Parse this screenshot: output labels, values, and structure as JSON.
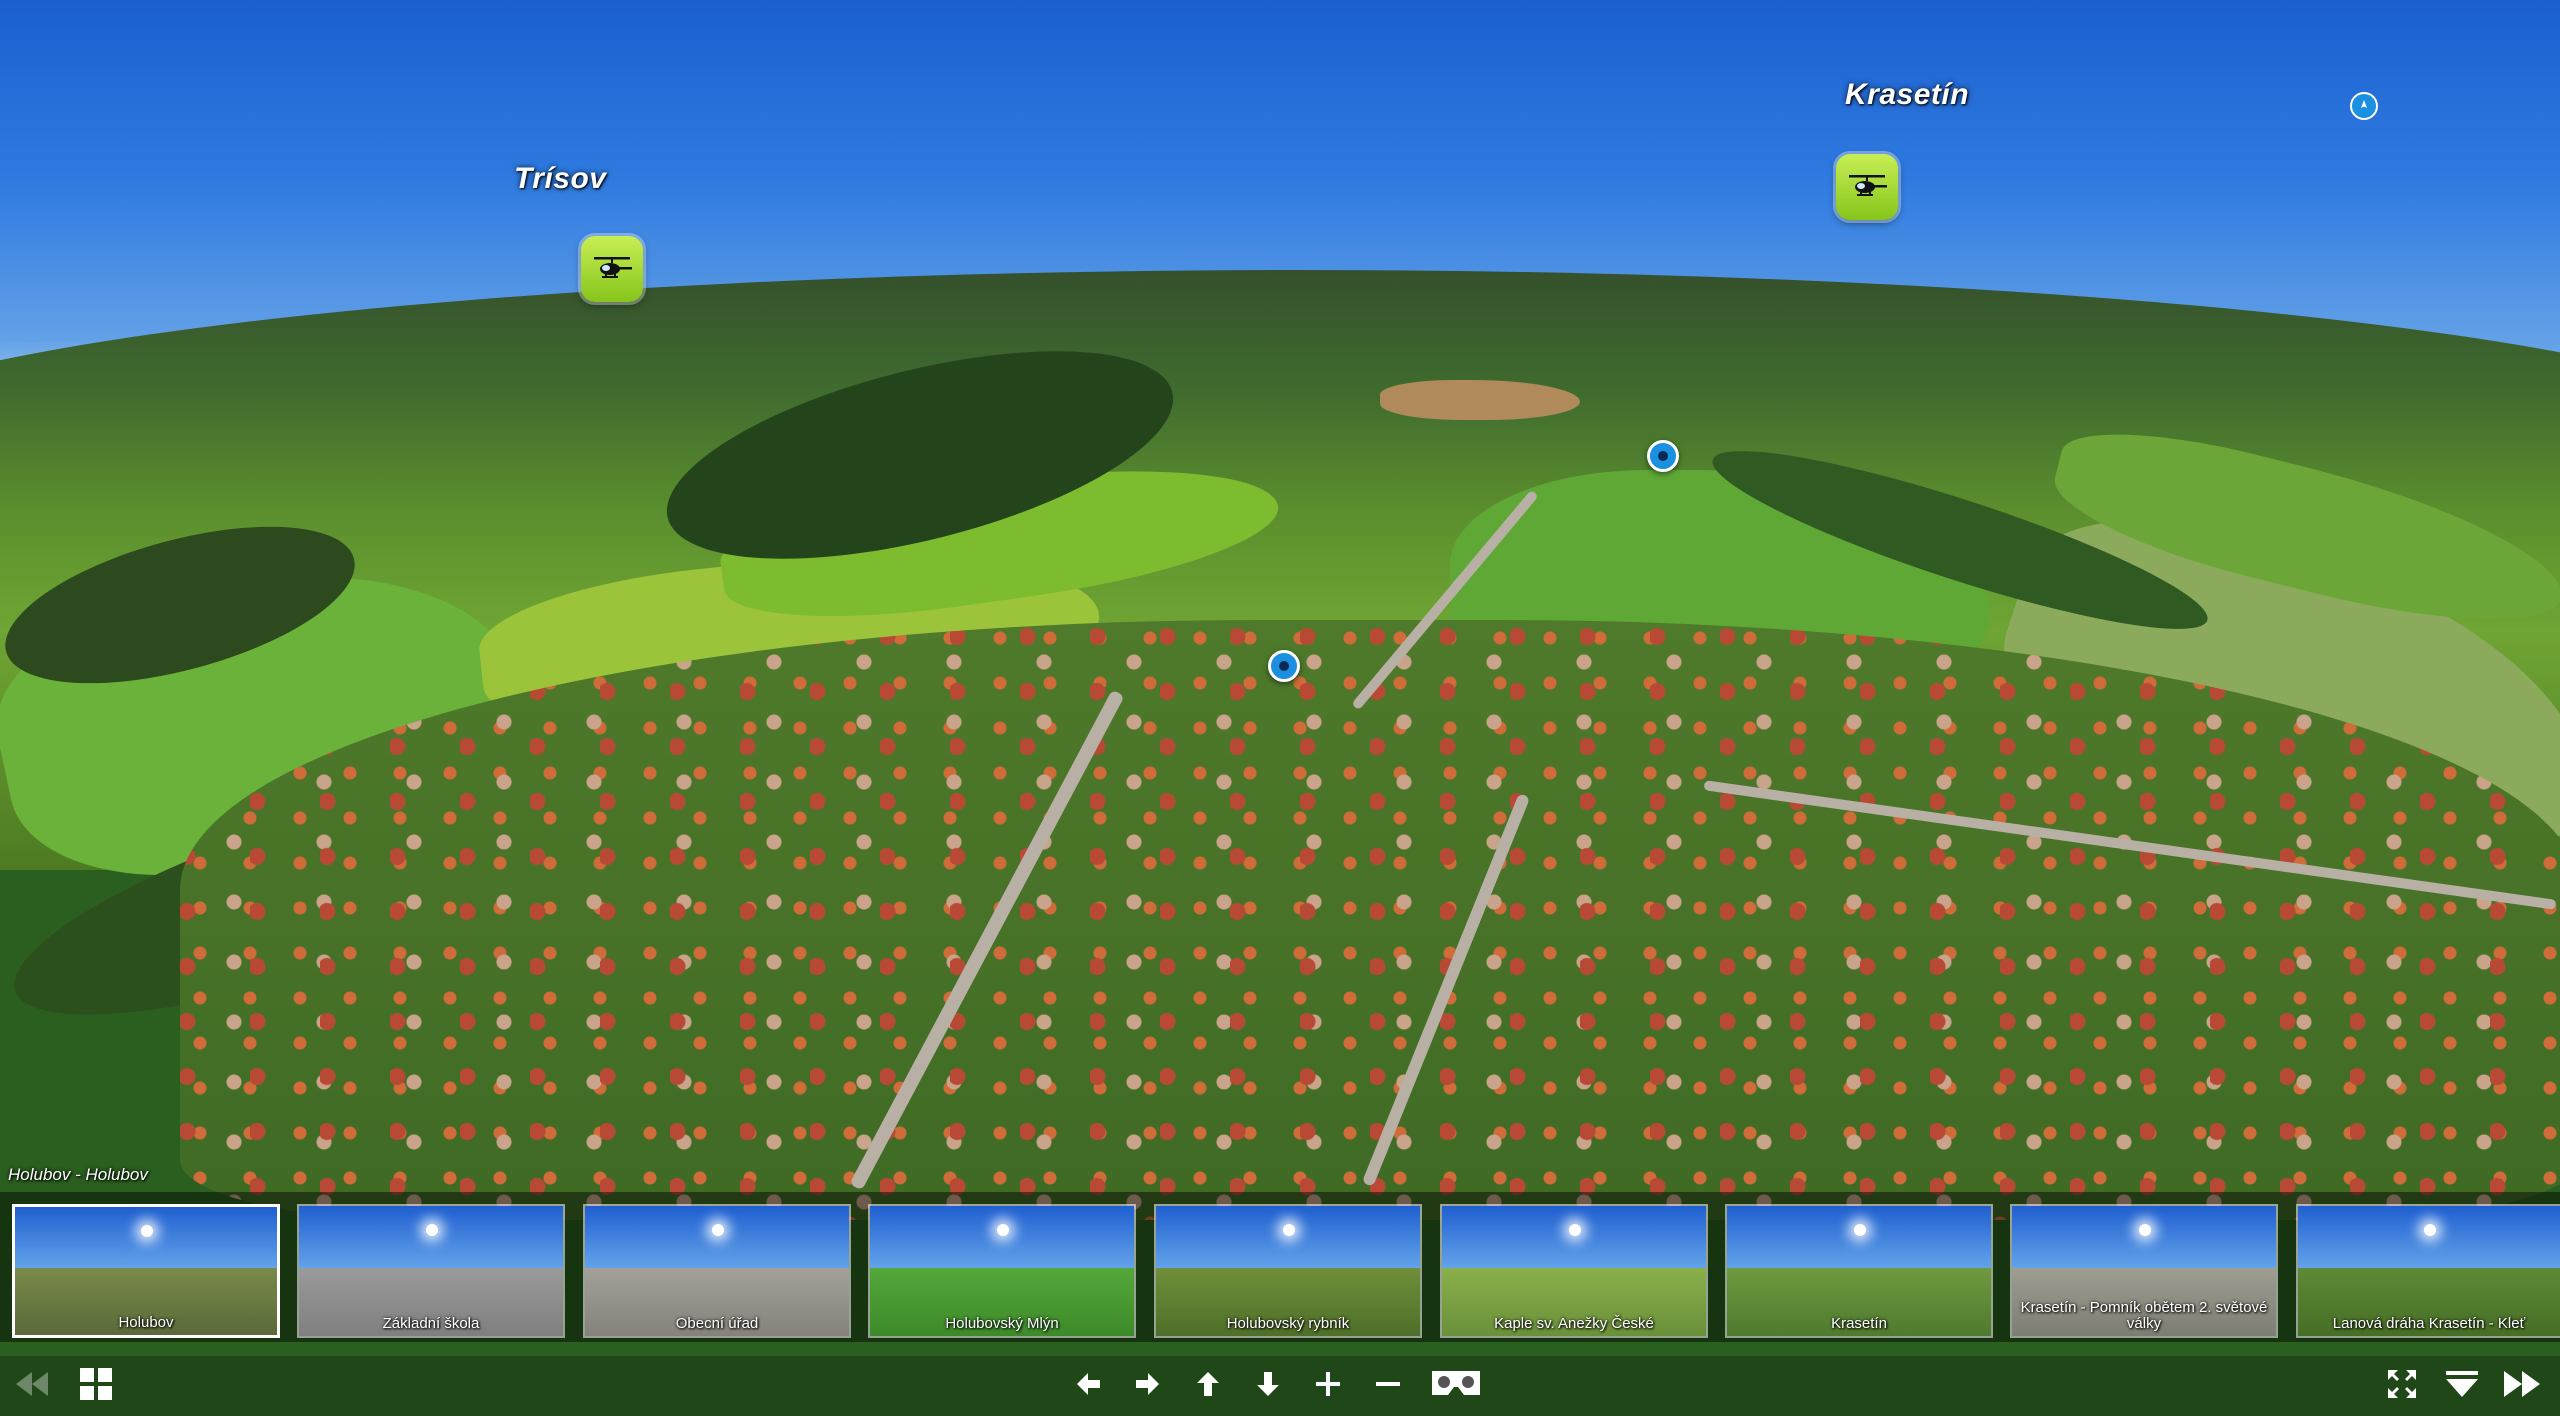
{
  "hotspots": {
    "trisov_label": "Trísov",
    "krasetin_label": "Krasetín"
  },
  "caption": "Holubov - Holubov",
  "thumbnails": [
    {
      "label": "Holubov",
      "ground": "#7a8a4a",
      "active": true
    },
    {
      "label": "Základní škola",
      "ground": "#9a9a9a",
      "active": false
    },
    {
      "label": "Obecní úřad",
      "ground": "#a3a09a",
      "active": false
    },
    {
      "label": "Holubovský Mlýn",
      "ground": "#55a83a",
      "active": false
    },
    {
      "label": "Holubovský rybník",
      "ground": "#6f8f3a",
      "active": false
    },
    {
      "label": "Kaple sv. Anežky České",
      "ground": "#8ab04a",
      "active": false
    },
    {
      "label": "Krasetín",
      "ground": "#6f9a3f",
      "active": false
    },
    {
      "label": "Krasetín - Pomník obětem 2. světové války",
      "ground": "#9d9d92",
      "active": false
    },
    {
      "label": "Lanová dráha Krasetín - Kleť",
      "ground": "#5e8a36",
      "active": false
    }
  ],
  "controls": {
    "icons": [
      "rewind-icon",
      "grid-icon",
      "arrow-left-icon",
      "arrow-right-icon",
      "arrow-up-icon",
      "arrow-down-icon",
      "zoom-in-icon",
      "zoom-out-icon",
      "vr-headset-icon",
      "fullscreen-icon",
      "hide-thumbnails-icon",
      "fast-forward-icon"
    ]
  },
  "colors": {
    "hotspot_green": "#9ad62a",
    "pin_blue": "#1b8fe0"
  }
}
